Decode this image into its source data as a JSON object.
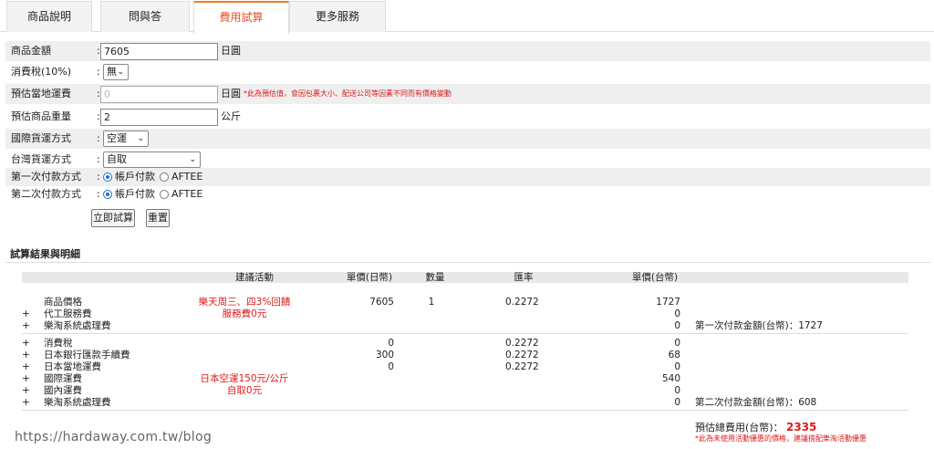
{
  "tabs": [
    {
      "label": "商品說明"
    },
    {
      "label": "問與答"
    },
    {
      "label": "費用試算"
    },
    {
      "label": "更多服務"
    }
  ],
  "form": {
    "price_label": "商品金額",
    "price_value": "7605",
    "price_unit": "日圓",
    "tax_label": "消費稅(10%)",
    "tax_value": "無",
    "shipping_jp_label": "預估當地運費",
    "shipping_jp_placeholder": "0",
    "shipping_jp_unit": "日圓",
    "shipping_jp_note": "*此為預估值，會因包裹大小、配送公司等因素不同而有價格變動",
    "weight_label": "預估商品重量",
    "weight_value": "2",
    "weight_unit": "公斤",
    "intl_label": "國際貨運方式",
    "intl_value": "空運",
    "tw_label": "台灣貨運方式",
    "tw_value": "自取",
    "pay1_label": "第一次付款方式",
    "pay2_label": "第二次付款方式",
    "opt_account": "帳戶付款",
    "opt_aftee": "AFTEE",
    "colon": ":"
  },
  "buttons": {
    "calc": "立即試算",
    "reset": "重置"
  },
  "result": {
    "title": "試算結果與明細",
    "headers": {
      "activity": "建議活動",
      "unit_jpy": "單價(日幣)",
      "qty": "數量",
      "rate": "匯率",
      "unit_twd": "單價(台幣)"
    },
    "plus": "+",
    "rows": [
      {
        "item": "商品價格",
        "activity": "樂天周三、四3%回饋",
        "jpy": "7605",
        "qty": "1",
        "rate": "0.2272",
        "twd": "1727",
        "sum": ""
      },
      {
        "item": "代工服務費",
        "activity": "服務費0元",
        "jpy": "",
        "qty": "",
        "rate": "",
        "twd": "0",
        "sum": ""
      },
      {
        "item": "樂淘系統處理費",
        "activity": "",
        "jpy": "",
        "qty": "",
        "rate": "",
        "twd": "0",
        "sum": "第一次付款金額(台幣)：1727"
      },
      {
        "item": "消費稅",
        "activity": "",
        "jpy": "0",
        "qty": "",
        "rate": "0.2272",
        "twd": "0",
        "sum": ""
      },
      {
        "item": "日本銀行匯款手續費",
        "activity": "",
        "jpy": "300",
        "qty": "",
        "rate": "0.2272",
        "twd": "68",
        "sum": ""
      },
      {
        "item": "日本當地運費",
        "activity": "",
        "jpy": "0",
        "qty": "",
        "rate": "0.2272",
        "twd": "0",
        "sum": ""
      },
      {
        "item": "國際運費",
        "activity": "日本空運150元/公斤",
        "jpy": "",
        "qty": "",
        "rate": "",
        "twd": "540",
        "sum": ""
      },
      {
        "item": "國內運費",
        "activity": "自取0元",
        "jpy": "",
        "qty": "",
        "rate": "",
        "twd": "0",
        "sum": ""
      },
      {
        "item": "樂淘系統處理費",
        "activity": "",
        "jpy": "",
        "qty": "",
        "rate": "",
        "twd": "0",
        "sum": "第二次付款金額(台幣)：608"
      }
    ],
    "total_label": "預估總費用(台幣)：",
    "total_value": "2335",
    "total_note": "*此為未使用活動優惠的價格，建議搭配樂淘活動優惠"
  },
  "watermark": "https://hardaway.com.tw/blog",
  "colors": {
    "accent": "#f07b2a",
    "alert": "#e01818",
    "radio": "#1a6fd6"
  }
}
